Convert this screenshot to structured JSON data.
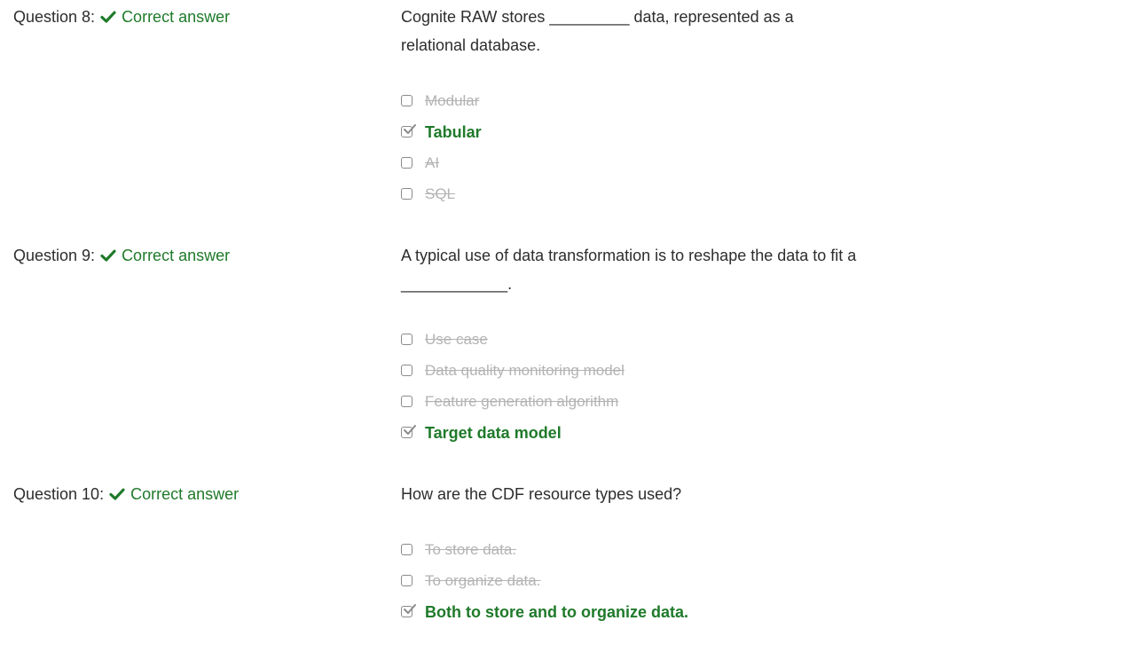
{
  "questions": [
    {
      "number": "Question 8:",
      "status": "Correct answer",
      "text": "Cognite RAW stores _________ data, represented as a relational database.",
      "options": [
        {
          "label": "Modular",
          "selected": false,
          "correct": false
        },
        {
          "label": "Tabular",
          "selected": true,
          "correct": true
        },
        {
          "label": "AI",
          "selected": false,
          "correct": false
        },
        {
          "label": "SQL",
          "selected": false,
          "correct": false
        }
      ]
    },
    {
      "number": "Question 9:",
      "status": "Correct answer",
      "text": "A typical use of data transformation is to reshape the data to fit a ____________.",
      "options": [
        {
          "label": "Use case",
          "selected": false,
          "correct": false
        },
        {
          "label": "Data quality monitoring model",
          "selected": false,
          "correct": false
        },
        {
          "label": "Feature generation algorithm",
          "selected": false,
          "correct": false
        },
        {
          "label": "Target data model",
          "selected": true,
          "correct": true
        }
      ]
    },
    {
      "number": "Question 10:",
      "status": "Correct answer",
      "text": "How are the CDF resource types used?",
      "options": [
        {
          "label": "To store data.",
          "selected": false,
          "correct": false
        },
        {
          "label": "To organize data.",
          "selected": false,
          "correct": false
        },
        {
          "label": "Both to store and to organize data.",
          "selected": true,
          "correct": true
        }
      ]
    }
  ],
  "colors": {
    "correct_green": "#1f7a2a",
    "struck_grey": "#b3b3b3",
    "text": "#2d2d2d"
  },
  "icons": {
    "status": "check-icon",
    "selected_box": "checked-checkbox-icon",
    "empty_box": "checkbox-icon"
  }
}
